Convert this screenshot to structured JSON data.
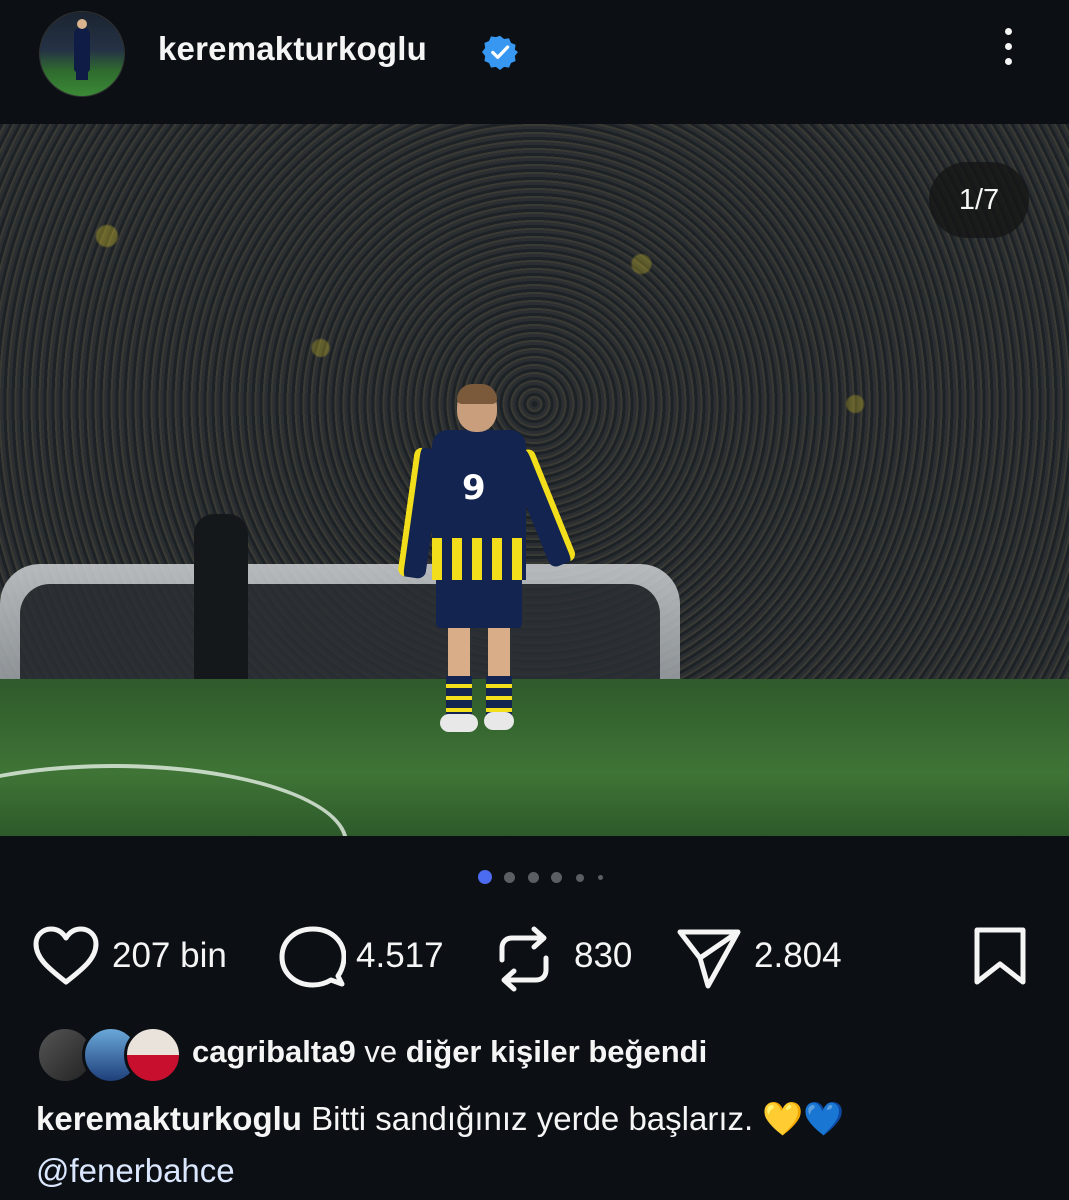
{
  "post": {
    "username": "keremakturkoglu",
    "verified": true,
    "icons": {
      "verified": "verified-badge-icon",
      "more": "more-vertical-icon"
    }
  },
  "media": {
    "counter": "1/7",
    "slides_total": 7,
    "slide_index": 1
  },
  "actions": {
    "likes": "207 bin",
    "comments": "4.517",
    "reposts": "830",
    "shares": "2.804",
    "icons": [
      "heart-icon",
      "comment-icon",
      "repost-icon",
      "share-icon",
      "bookmark-icon"
    ]
  },
  "liked_by": {
    "user": "cagribalta9",
    "connector": "ve",
    "rest": "diğer kişiler beğendi"
  },
  "caption": {
    "username": "keremakturkoglu",
    "text": "Bitti sandığınız yerde başlarız. 💛💙",
    "mention": "@fenerbahce"
  },
  "colors": {
    "background": "#0c1014",
    "verified": "#3897f0",
    "active_dot": "#4b6cf0"
  }
}
